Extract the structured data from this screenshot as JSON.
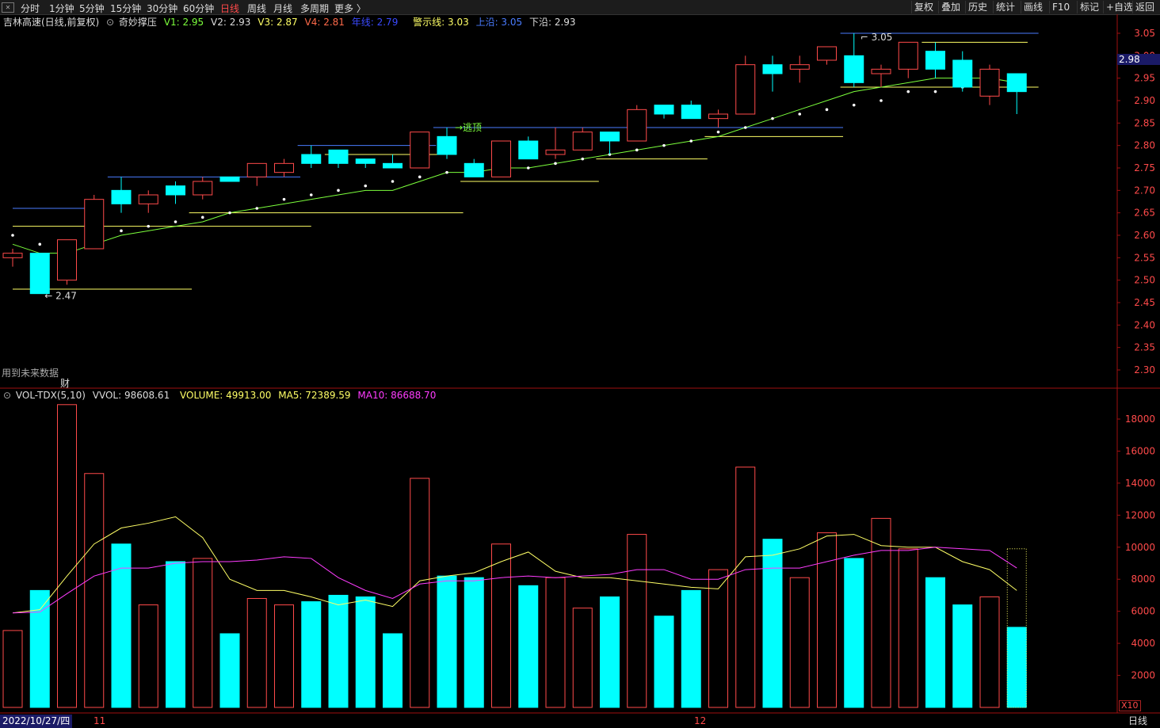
{
  "toolbar": {
    "left_tabs": [
      "分时",
      "1分钟",
      "5分钟",
      "15分钟",
      "30分钟",
      "60分钟",
      "日线",
      "周线",
      "月线",
      "多周期",
      "更多 〉"
    ],
    "active_tab": "日线",
    "right_tabs": [
      "复权",
      "叠加",
      "历史",
      "统计",
      "画线",
      "F10",
      "标记",
      "+自选",
      "返回"
    ]
  },
  "info": {
    "stock": "吉林高速(日线,前复权)",
    "indicator": "奇妙撑压",
    "v1": "V1: 2.95",
    "v2": "V2: 2.93",
    "v3": "V3: 2.87",
    "v4": "V4: 2.81",
    "nianxian": "年线: 2.79",
    "jingshi": "警示线: 3.03",
    "shangyan": "上沿: 3.05",
    "xiayan": "下沿: 2.93"
  },
  "vol_info": {
    "name": "VOL-TDX(5,10)",
    "vvol": "VVOL: 98608.61",
    "volume": "VOLUME: 49913.00",
    "ma5": "MA5: 72389.59",
    "ma10": "MA10: 86688.70"
  },
  "labels": {
    "warning": "用到未来数据",
    "cai": "财",
    "date": "2022/10/27/四",
    "month_11": "11",
    "month_12": "12",
    "period": "日线",
    "x10": "X10",
    "price_tag": "2.98",
    "high_label": "3.05",
    "low_label": "2.47",
    "escape_label": "逃顶"
  },
  "colors": {
    "up": "#ff4a4a",
    "down": "#00ffff",
    "ma_green": "#7cff3c",
    "vma5": "#ffff66",
    "vma10": "#ff3cff",
    "blue_line": "#4a7cff",
    "yellow_line": "#ffff66",
    "grid_axis": "#a01010"
  },
  "chart_data": [
    {
      "type": "candlestick",
      "title": "吉林高速(日线,前复权)",
      "y_ticks": [
        3.05,
        3.0,
        2.95,
        2.9,
        2.85,
        2.8,
        2.75,
        2.7,
        2.65,
        2.6,
        2.55,
        2.5,
        2.45,
        2.4,
        2.35,
        2.3
      ],
      "ylim": [
        2.27,
        3.07
      ],
      "candles": [
        {
          "o": 2.55,
          "h": 2.57,
          "l": 2.53,
          "c": 2.56
        },
        {
          "o": 2.56,
          "h": 2.56,
          "l": 2.47,
          "c": 2.47
        },
        {
          "o": 2.5,
          "h": 2.59,
          "l": 2.49,
          "c": 2.59
        },
        {
          "o": 2.57,
          "h": 2.69,
          "l": 2.57,
          "c": 2.68
        },
        {
          "o": 2.7,
          "h": 2.73,
          "l": 2.65,
          "c": 2.67
        },
        {
          "o": 2.67,
          "h": 2.7,
          "l": 2.65,
          "c": 2.69
        },
        {
          "o": 2.71,
          "h": 2.72,
          "l": 2.67,
          "c": 2.69
        },
        {
          "o": 2.69,
          "h": 2.73,
          "l": 2.68,
          "c": 2.72
        },
        {
          "o": 2.73,
          "h": 2.73,
          "l": 2.72,
          "c": 2.72
        },
        {
          "o": 2.73,
          "h": 2.76,
          "l": 2.71,
          "c": 2.76
        },
        {
          "o": 2.74,
          "h": 2.77,
          "l": 2.73,
          "c": 2.76
        },
        {
          "o": 2.78,
          "h": 2.8,
          "l": 2.75,
          "c": 2.76
        },
        {
          "o": 2.79,
          "h": 2.79,
          "l": 2.75,
          "c": 2.76
        },
        {
          "o": 2.77,
          "h": 2.77,
          "l": 2.75,
          "c": 2.76
        },
        {
          "o": 2.76,
          "h": 2.78,
          "l": 2.75,
          "c": 2.75
        },
        {
          "o": 2.75,
          "h": 2.83,
          "l": 2.75,
          "c": 2.83
        },
        {
          "o": 2.82,
          "h": 2.84,
          "l": 2.77,
          "c": 2.78
        },
        {
          "o": 2.76,
          "h": 2.77,
          "l": 2.73,
          "c": 2.73
        },
        {
          "o": 2.73,
          "h": 2.81,
          "l": 2.73,
          "c": 2.81
        },
        {
          "o": 2.81,
          "h": 2.82,
          "l": 2.77,
          "c": 2.77
        },
        {
          "o": 2.78,
          "h": 2.84,
          "l": 2.77,
          "c": 2.79
        },
        {
          "o": 2.79,
          "h": 2.84,
          "l": 2.79,
          "c": 2.83
        },
        {
          "o": 2.83,
          "h": 2.83,
          "l": 2.78,
          "c": 2.81
        },
        {
          "o": 2.81,
          "h": 2.89,
          "l": 2.81,
          "c": 2.88
        },
        {
          "o": 2.89,
          "h": 2.89,
          "l": 2.86,
          "c": 2.87
        },
        {
          "o": 2.89,
          "h": 2.9,
          "l": 2.86,
          "c": 2.86
        },
        {
          "o": 2.86,
          "h": 2.88,
          "l": 2.84,
          "c": 2.87
        },
        {
          "o": 2.87,
          "h": 3.0,
          "l": 2.87,
          "c": 2.98
        },
        {
          "o": 2.98,
          "h": 3.0,
          "l": 2.92,
          "c": 2.96
        },
        {
          "o": 2.97,
          "h": 3.0,
          "l": 2.94,
          "c": 2.98
        },
        {
          "o": 2.99,
          "h": 3.01,
          "l": 2.98,
          "c": 3.02
        },
        {
          "o": 3.0,
          "h": 3.05,
          "l": 2.93,
          "c": 2.94
        },
        {
          "o": 2.96,
          "h": 2.98,
          "l": 2.93,
          "c": 2.97
        },
        {
          "o": 2.97,
          "h": 3.03,
          "l": 2.95,
          "c": 3.03
        },
        {
          "o": 3.01,
          "h": 3.03,
          "l": 2.95,
          "c": 2.97
        },
        {
          "o": 2.99,
          "h": 3.01,
          "l": 2.92,
          "c": 2.93
        },
        {
          "o": 2.91,
          "h": 2.98,
          "l": 2.89,
          "c": 2.97
        },
        {
          "o": 2.96,
          "h": 2.96,
          "l": 2.87,
          "c": 2.92
        }
      ],
      "ma_line": [
        2.58,
        2.56,
        2.56,
        2.58,
        2.6,
        2.61,
        2.62,
        2.63,
        2.65,
        2.66,
        2.67,
        2.68,
        2.69,
        2.7,
        2.7,
        2.72,
        2.74,
        2.74,
        2.75,
        2.75,
        2.76,
        2.77,
        2.78,
        2.79,
        2.8,
        2.81,
        2.82,
        2.84,
        2.86,
        2.88,
        2.9,
        2.92,
        2.93,
        2.94,
        2.95,
        2.95,
        2.95,
        2.94
      ],
      "dots": [
        2.6,
        2.58,
        2.56,
        2.59,
        2.61,
        2.62,
        2.63,
        2.64,
        2.65,
        2.66,
        2.68,
        2.69,
        2.7,
        2.71,
        2.72,
        2.73,
        2.74,
        2.74,
        2.75,
        2.75,
        2.76,
        2.77,
        2.78,
        2.79,
        2.8,
        2.81,
        2.83,
        2.84,
        2.86,
        2.87,
        2.88,
        2.89,
        2.9,
        2.92,
        2.92,
        2.93,
        2.93,
        2.94
      ]
    },
    {
      "type": "bar",
      "title": "VOL-TDX(5,10)",
      "y_ticks": [
        18000,
        16000,
        14000,
        12000,
        10000,
        8000,
        6000,
        4000,
        2000
      ],
      "ylim": [
        0,
        19400
      ],
      "volumes": [
        4800,
        7300,
        18900,
        14600,
        10200,
        6400,
        9100,
        9300,
        4600,
        6800,
        6400,
        6600,
        7000,
        6900,
        4600,
        14300,
        8200,
        8100,
        10200,
        7600,
        8100,
        6200,
        6900,
        10800,
        5700,
        7300,
        8600,
        15000,
        10500,
        8100,
        10900,
        9300,
        11800,
        9900,
        8100,
        6400,
        6900,
        5000
      ],
      "ma5": [
        5900,
        6100,
        8200,
        10200,
        11200,
        11500,
        11900,
        10600,
        8000,
        7300,
        7300,
        6900,
        6400,
        6700,
        6300,
        7900,
        8200,
        8400,
        9100,
        9700,
        8500,
        8100,
        8100,
        7900,
        7700,
        7500,
        7400,
        9400,
        9500,
        9900,
        10700,
        10800,
        10100,
        10000,
        10000,
        9100,
        8600,
        7300
      ],
      "ma10": [
        5900,
        5950,
        7100,
        8200,
        8700,
        8700,
        9000,
        9100,
        9100,
        9200,
        9400,
        9300,
        8100,
        7300,
        6800,
        7700,
        7900,
        7900,
        8100,
        8200,
        8100,
        8200,
        8300,
        8600,
        8600,
        8000,
        8000,
        8600,
        8700,
        8700,
        9100,
        9500,
        9800,
        9800,
        10000,
        9900,
        9800,
        8700
      ]
    }
  ]
}
